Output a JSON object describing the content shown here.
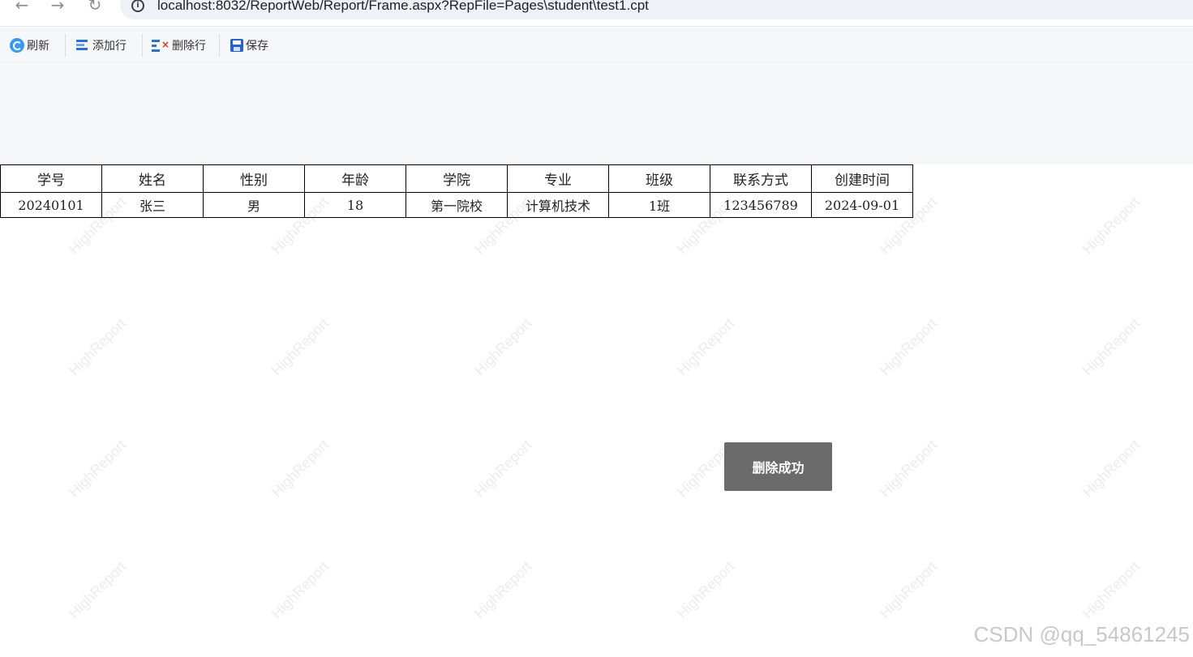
{
  "browser": {
    "url": "localhost:8032/ReportWeb/Report/Frame.aspx?RepFile=Pages\\student\\test1.cpt",
    "back_glyph": "←",
    "forward_glyph": "→",
    "reload_glyph": "↻",
    "info_glyph": "i"
  },
  "toolbar": {
    "refresh_label": "刷新",
    "add_row_label": "添加行",
    "delete_row_label": "删除行",
    "save_label": "保存",
    "delete_mark": "×"
  },
  "table": {
    "headers": [
      "学号",
      "姓名",
      "性别",
      "年龄",
      "学院",
      "专业",
      "班级",
      "联系方式",
      "创建时间"
    ],
    "rows": [
      [
        "20240101",
        "张三",
        "男",
        "18",
        "第一院校",
        "计算机技术",
        "1班",
        "123456789",
        "2024-09-01"
      ]
    ]
  },
  "watermark_text": "HighReport",
  "toast": {
    "message": "删除成功"
  },
  "footer_mark": "CSDN @qq_54861245",
  "colors": {
    "toolbar_bg": "#f6f7f9",
    "toast_bg": "#6b6b6b",
    "accent_blue": "#3a9af0",
    "delete_red": "#d9342b"
  },
  "icons": {
    "refresh": "refresh-icon",
    "add_row": "add-row-icon",
    "delete_row": "delete-row-icon",
    "save": "save-icon"
  }
}
